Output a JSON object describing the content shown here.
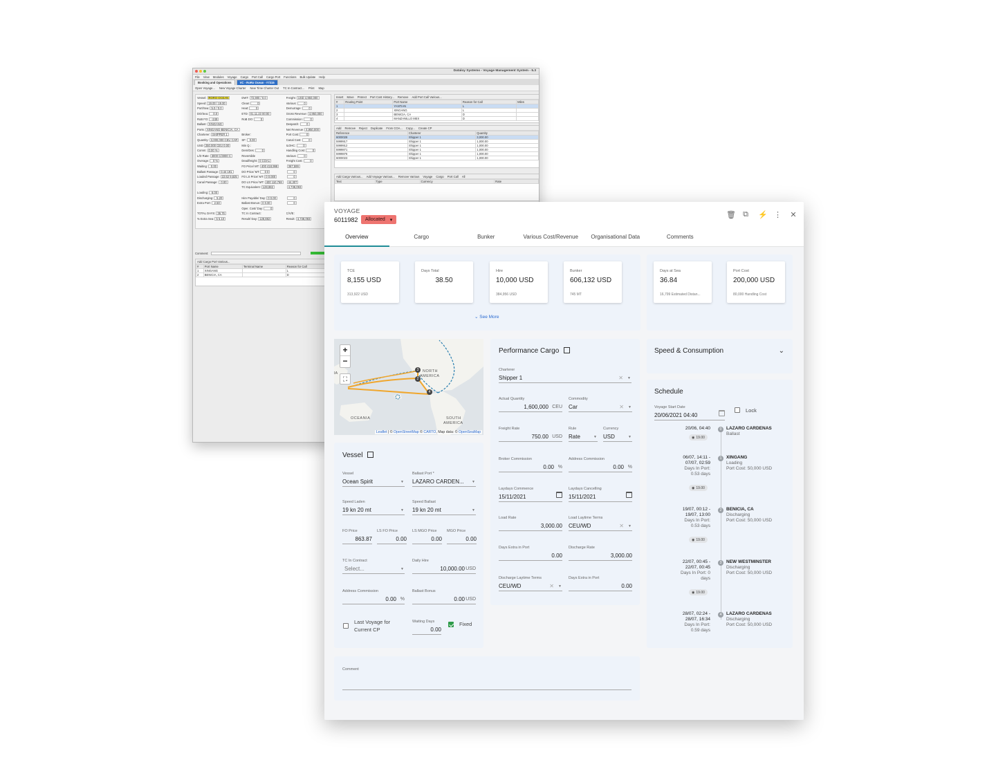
{
  "legacy": {
    "title": "Dataloy Systems - Voyage Management System - 5.3",
    "menu": [
      "File",
      "View",
      "Modules",
      "Voyage",
      "Cargo",
      "Port Call",
      "Cargo Port",
      "Functions",
      "Bulk Update",
      "Help"
    ],
    "tabs": [
      "Booking and Operations",
      "VC - RoRo Ocean - #7315"
    ],
    "toolbar": [
      "Open Voyage...",
      "New Voyage Charter",
      "New Time Charter Out",
      "TC In Contract...",
      "Print",
      "Map"
    ],
    "form": [
      [
        "Vessel:",
        "RORO OCEAN"
      ],
      [
        "DWT:",
        "72,900 / 0.0"
      ],
      [
        "Freight:",
        "USD 4,950,000"
      ],
      [
        "Speed:",
        "19.00 / 19.00"
      ],
      [
        "Clean:",
        "0"
      ],
      [
        "Various:",
        "0"
      ],
      [
        "Port/Sea:",
        "5.0 / 0.0"
      ],
      [
        "Heat:",
        "0"
      ],
      [
        "Demurrage:",
        "0"
      ],
      [
        "DO/Sea:",
        "0.0"
      ],
      [
        "ETD:",
        "01.11.23 00:00"
      ],
      [
        "Gross Revenue:",
        "4,950,000"
      ],
      [
        "RoB FO:",
        "-249"
      ],
      [
        "RoB DO:",
        "0"
      ],
      [
        "Commission:",
        "0"
      ],
      [
        "Ballast:",
        "XINGANG"
      ],
      [
        "",
        ""
      ],
      [
        "Despatch:",
        "0"
      ],
      [
        "Ports:",
        "XINGANG-BENICIA, CA"
      ],
      [
        "",
        ""
      ],
      [
        "Net Revenue:",
        "4,950,000"
      ],
      [
        "Charterer:",
        "SHIPPER 1"
      ],
      [
        "Broker:",
        ""
      ],
      [
        "Port Cost:",
        "0"
      ],
      [
        "Quantity:",
        "3,000,000 CEU CAR"
      ],
      [
        "SF:",
        "0.00"
      ],
      [
        "Canal Cost:",
        "0"
      ],
      [
        "USD",
        "250.000 CEU 0.00"
      ],
      [
        "Min Q.:",
        ""
      ],
      [
        "ILOHC:",
        "0"
      ],
      [
        "Comm:",
        "0.00 %"
      ],
      [
        "Dem/Des:",
        "0"
      ],
      [
        "Handling Cost:",
        "0"
      ],
      [
        "L/D Rate:",
        "3000 C/3000 C"
      ],
      [
        "Reversible",
        ""
      ],
      [
        "Various:",
        "0"
      ],
      [
        "Overage:",
        "0 %"
      ],
      [
        "Deadfreight:",
        "0 COA1"
      ],
      [
        "Freight Cost:",
        "0"
      ],
      [
        "Waiting:",
        "0.00"
      ],
      [
        "FO Price/ MT:",
        "400 418,998"
      ],
      [
        "",
        "367,599"
      ],
      [
        "Ballast Passage:",
        "0.44 191"
      ],
      [
        "DO Price/ MT:",
        "0 0"
      ],
      [
        "",
        "0"
      ],
      [
        "Loaded Passage:",
        "22.62 9,825"
      ],
      [
        "FO LS Price/ MT:",
        "0 0.000"
      ],
      [
        "",
        "0"
      ],
      [
        "Canal Passage:",
        "0.00"
      ],
      [
        "DO LS Price/ MT:",
        "400 110,768"
      ],
      [
        "",
        "44,307"
      ],
      [
        "",
        ""
      ],
      [
        "TC Equivalent:",
        "128,882"
      ],
      [
        "",
        "4,738,093"
      ],
      [
        "Loading:",
        "6.00"
      ],
      [
        "",
        ""
      ],
      [
        "",
        ""
      ],
      [
        "Discharging:",
        "5.20"
      ],
      [
        "Hire Payable/ Day:",
        "0 0.00"
      ],
      [
        "",
        "0"
      ],
      [
        "Extra Port:",
        "2.50"
      ],
      [
        "Ballast Bonus:",
        "0 0.00"
      ],
      [
        "",
        "0"
      ],
      [
        "",
        ""
      ],
      [
        "Oper. Cost/ Day:",
        "0"
      ],
      [
        "",
        ""
      ],
      [
        "TOTAL DAYS:",
        "36.76"
      ],
      [
        "TC In Contract:",
        ""
      ],
      [
        "C/V/E:",
        ""
      ],
      [
        "% Extra Sea:",
        "5 5.10"
      ],
      [
        "Result/ Day:",
        "128,882"
      ],
      [
        "Result:",
        "4,738,093"
      ]
    ],
    "routing_toolbar": [
      "Insert",
      "Move",
      "Protect",
      "Port Cost History...",
      "Remove",
      "Add Port Call Various..."
    ],
    "routing_headers": [
      "#",
      "Routing Point",
      "Port Name",
      "Reason for Call",
      "Miles"
    ],
    "routing_rows": [
      [
        "1",
        "",
        "YANTIAN",
        "L",
        ""
      ],
      [
        "2",
        "",
        "XINGANG",
        "L",
        ""
      ],
      [
        "3",
        "",
        "BENICIA, CA",
        "D",
        ""
      ],
      [
        "4",
        "",
        "MANZANILLO MEX",
        "D",
        ""
      ]
    ],
    "cargo_toolbar": [
      "Add",
      "Remove",
      "Reject",
      "Duplicate",
      "From COA...",
      "Copy...",
      "Create CP"
    ],
    "cargo_headers": [
      "Reference",
      "Charterer",
      "Quantity"
    ],
    "cargo_rows": [
      [
        "6000028",
        "Shipper 1",
        "3,000.00"
      ],
      [
        "5999917",
        "Shipper 1",
        "1,000.00"
      ],
      [
        "5999912",
        "Shipper 1",
        "1,000.00"
      ],
      [
        "5999871",
        "Shipper 1",
        "1,000.00"
      ],
      [
        "5999876",
        "Shipper 1",
        "1,000.00"
      ],
      [
        "6000023",
        "Shipper 1",
        "1,000.00"
      ]
    ],
    "various_toolbar": [
      "Add Cargo Various...",
      "Add Voyage Various...",
      "Remove Various",
      "Voyage",
      "Cargo",
      "Port Call",
      "All"
    ],
    "various_headers": [
      "Text",
      "Type",
      "Currency",
      "Rate"
    ],
    "comment_label": "Comment:",
    "portcall_toolbar": [
      "Add Cargo Port Various..."
    ],
    "portcall_headers": [
      "#",
      "Port Name",
      "Terminal Name",
      "Reason for Call"
    ],
    "portcall_rows": [
      [
        "1",
        "XINGANG",
        "",
        "L"
      ],
      [
        "2",
        "BENICIA, CA",
        "",
        "D"
      ]
    ]
  },
  "header": {
    "label": "VOYAGE",
    "number": "6011982",
    "status": "Allocated"
  },
  "tabs": [
    "Overview",
    "Cargo",
    "Bunker",
    "Various Cost/Revenue",
    "Organisational Data",
    "Comments"
  ],
  "kpis": [
    {
      "label": "TCE",
      "value": "8,155 USD",
      "sub": "313,922 USD"
    },
    {
      "label": "Days Total",
      "value": "38.50",
      "sub": ""
    },
    {
      "label": "Hire",
      "value": "10,000 USD",
      "sub": "384,956 USD"
    },
    {
      "label": "Bunker",
      "value": "606,132 USD",
      "sub": "745 MT"
    }
  ],
  "kpis2": [
    {
      "label": "Days at Sea",
      "value": "36.84",
      "sub": "16,799 Estimated Distan..."
    },
    {
      "label": "Port Cost",
      "value": "200,000 USD",
      "sub": "80,000 Handling Cost"
    }
  ],
  "see_more": "See More",
  "map": {
    "labels": [
      "NORTH",
      "AMERICA",
      "SOUTH",
      "AMERICA",
      "OCEANIA",
      "IA"
    ],
    "markers": [
      "3",
      "2",
      "4"
    ],
    "zoom_in": "+",
    "zoom_out": "−",
    "attr_leaflet": "Leaflet",
    "attr_rest1": " | © ",
    "attr_osm": "OpenStreetMap",
    "attr_rest2": " © ",
    "attr_carto": "CARTO",
    "attr_rest3": ", Map data: © ",
    "attr_sea": "OpenSeaMap"
  },
  "vessel": {
    "title": "Vessel",
    "vessel": {
      "label": "Vessel",
      "value": "Ocean Spirit"
    },
    "ballast_port": {
      "label": "Ballast Port *",
      "value": "LAZARO CARDEN..."
    },
    "speed_laden": {
      "label": "Speed Laden",
      "value": "19 kn 20 mt"
    },
    "speed_ballast": {
      "label": "Speed Ballast",
      "value": "19 kn 20 mt"
    },
    "fo_price": {
      "label": "FO Price",
      "value": "863.87"
    },
    "ls_fo_price": {
      "label": "LS FO Price",
      "value": "0.00"
    },
    "ls_mgo_price": {
      "label": "LS MGO Price",
      "value": "0.00"
    },
    "mgo_price": {
      "label": "MGO Price",
      "value": "0.00"
    },
    "tc_in_contract": {
      "label": "TC In Contract",
      "value": "Select..."
    },
    "daily_hire": {
      "label": "Daily Hire",
      "value": "10,000.00",
      "unit": "USD"
    },
    "address_commission": {
      "label": "Address Commission",
      "value": "0.00",
      "unit": "%"
    },
    "ballast_bonus": {
      "label": "Ballast Bonus",
      "value": "0.00",
      "unit": "USD"
    },
    "last_voyage": "Last Voyage for Current CP",
    "waiting_days": {
      "label": "Waiting Days",
      "value": "0.00"
    },
    "fixed": "Fixed"
  },
  "perf": {
    "title": "Performance Cargo",
    "charterer": {
      "label": "Charterer",
      "value": "Shipper 1"
    },
    "actual_quantity": {
      "label": "Actual Quantity",
      "value": "1,600,000",
      "unit": "CEU"
    },
    "commodity": {
      "label": "Commodity",
      "value": "Car"
    },
    "freight_rate": {
      "label": "Freight Rate",
      "value": "750.00",
      "unit": "USD"
    },
    "rule": {
      "label": "Rule",
      "value": "Rate"
    },
    "currency": {
      "label": "Currency",
      "value": "USD"
    },
    "broker_commission": {
      "label": "Broker Commission",
      "value": "0.00",
      "unit": "%"
    },
    "address_commission": {
      "label": "Address Commission",
      "value": "0.00",
      "unit": "%"
    },
    "laydays_commence": {
      "label": "Laydays Commence",
      "value": "15/11/2021"
    },
    "laydays_cancelling": {
      "label": "Laydays Cancelling",
      "value": "15/11/2021"
    },
    "load_rate": {
      "label": "Load Rate",
      "value": "3,000.00"
    },
    "load_laytime_terms": {
      "label": "Load Laytime Terms",
      "value": "CEU/WD"
    },
    "days_extra_port": {
      "label": "Days Extra in Port",
      "value": "0.00"
    },
    "discharge_rate": {
      "label": "Discharge Rate",
      "value": "3,000.00"
    },
    "discharge_laytime_terms": {
      "label": "Discharge Laytime Terms",
      "value": "CEU/WD"
    },
    "days_extra_port2": {
      "label": "Days Extra in Port",
      "value": "0.00"
    }
  },
  "comment": {
    "label": "Comment"
  },
  "speed": {
    "title": "Speed & Consumption"
  },
  "schedule": {
    "title": "Schedule",
    "start": {
      "label": "Voyage Start Date",
      "value": "20/06/2021 04:40"
    },
    "lock": "Lock",
    "stops": [
      {
        "num": "0",
        "date": "20/06, 04:40",
        "port": "LAZARO CARDENAS",
        "type": "Ballast",
        "days": "",
        "cost": "",
        "chip": "19.00"
      },
      {
        "num": "1",
        "date": "06/07, 14:11 -",
        "date2": "07/07, 02:59",
        "port": "XINGANG",
        "type": "Loading",
        "days": "Days In Port:",
        "days2": "0.53 days",
        "cost": "Port Cost: 50,000 USD",
        "chip": "19.00"
      },
      {
        "num": "2",
        "date": "19/07, 00:12 -",
        "date2": "19/07, 13:00",
        "port": "BENICIA, CA",
        "type": "Discharging",
        "days": "Days In Port:",
        "days2": "0.53 days",
        "cost": "Port Cost: 50,000 USD",
        "chip": "19.00"
      },
      {
        "num": "3",
        "date": "22/07, 00:45 -",
        "date2": "22/07, 00:45",
        "port": "NEW WESTMINSTER",
        "type": "Discharging",
        "days": "Days In Port: 0",
        "days2": "days",
        "cost": "Port Cost: 50,000 USD",
        "chip": "19.00"
      },
      {
        "num": "4",
        "date": "28/07, 02:24 -",
        "date2": "28/07, 16:34",
        "port": "LAZARO CARDENAS",
        "type": "Discharging",
        "days": "Days In Port:",
        "days2": "0.59 days",
        "cost": "Port Cost: 50,000 USD",
        "chip": ""
      }
    ]
  },
  "colors": {
    "teal": "#1e8c96",
    "status": "#ee7470",
    "route": "#f0a62c",
    "link": "#2a6ad0"
  }
}
